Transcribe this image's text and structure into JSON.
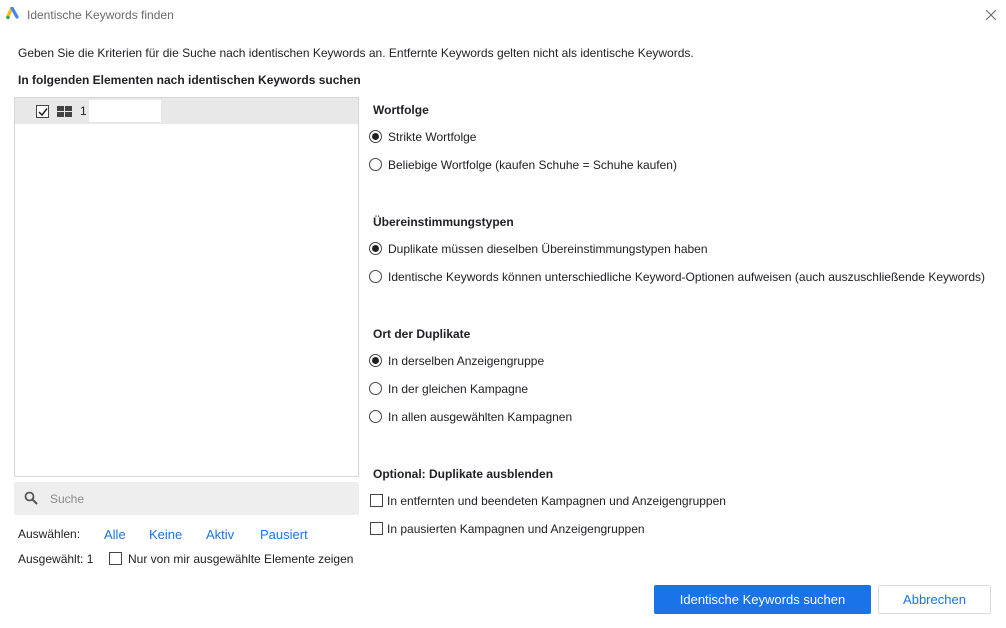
{
  "window": {
    "title": "Identische Keywords finden"
  },
  "intro_text": "Geben Sie die Kriterien für die Suche nach identischen Keywords an. Entfernte Keywords gelten nicht als identische Keywords.",
  "tree": {
    "heading": "In folgenden Elementen nach identischen Keywords suchen",
    "items": [
      {
        "label": "1",
        "checked": true,
        "icon": "account-grid-icon"
      }
    ]
  },
  "search": {
    "placeholder": "Suche",
    "value": ""
  },
  "select": {
    "label": "Auswählen:",
    "links": [
      "Alle",
      "Keine",
      "Aktiv",
      "Pausiert"
    ]
  },
  "selected": {
    "count_text": "Ausgewählt: 1",
    "only_mine_label": "Nur von mir ausgewählte Elemente zeigen",
    "only_mine_checked": false
  },
  "sections": {
    "word_order": {
      "heading": "Wortfolge",
      "options": [
        "Strikte Wortfolge",
        "Beliebige Wortfolge (kaufen Schuhe = Schuhe kaufen)"
      ],
      "selected_index": 0
    },
    "match_types": {
      "heading": "Übereinstimmungstypen",
      "options": [
        "Duplikate müssen dieselben Übereinstimmungstypen haben",
        "Identische Keywords können unterschiedliche Keyword-Optionen aufweisen (auch auszuschließende Keywords)"
      ],
      "selected_index": 0
    },
    "location": {
      "heading": "Ort der Duplikate",
      "options": [
        "In derselben Anzeigengruppe",
        "In der gleichen Kampagne",
        "In allen ausgewählten Kampagnen"
      ],
      "selected_index": 0
    },
    "hide": {
      "heading": "Optional: Duplikate ausblenden",
      "options": [
        "In entfernten und beendeten Kampagnen und Anzeigengruppen",
        "In pausierten Kampagnen und Anzeigengruppen"
      ],
      "checked": [
        false,
        false
      ]
    }
  },
  "buttons": {
    "find": "Identische Keywords suchen",
    "cancel": "Abbrechen"
  },
  "colors": {
    "accent": "#1a73e8",
    "row_highlight": "#e8e8e8",
    "search_bg": "#eeeeee",
    "logo_blue": "#4285f4",
    "logo_yellow": "#fbbc04",
    "logo_green": "#34a853"
  }
}
